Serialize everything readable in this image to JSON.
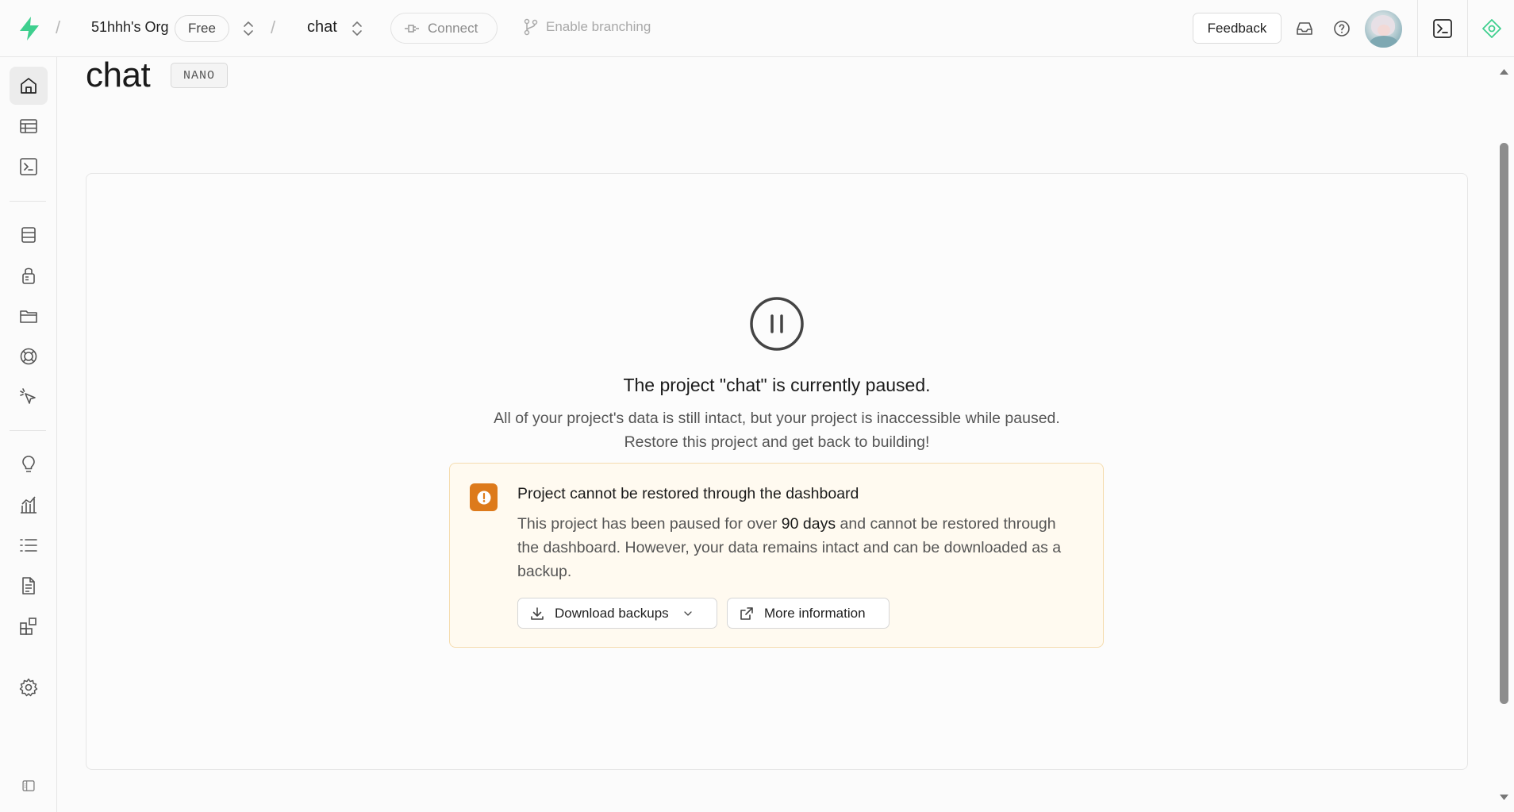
{
  "topbar": {
    "org_name": "51hhh's Org",
    "plan_badge": "Free",
    "project_name": "chat",
    "connect_label": "Connect",
    "branching_label": "Enable branching",
    "feedback_label": "Feedback"
  },
  "sidebar": {
    "items": [
      {
        "name": "home",
        "active": true
      },
      {
        "name": "table-editor"
      },
      {
        "name": "sql-editor"
      },
      {
        "name": "database"
      },
      {
        "name": "authentication"
      },
      {
        "name": "storage"
      },
      {
        "name": "edge-functions"
      },
      {
        "name": "realtime"
      },
      {
        "name": "advisors"
      },
      {
        "name": "reports"
      },
      {
        "name": "logs"
      },
      {
        "name": "api-docs"
      },
      {
        "name": "integrations"
      },
      {
        "name": "project-settings"
      }
    ]
  },
  "main": {
    "title": "chat",
    "compute_badge": "NANO",
    "paused_title": "The project \"chat\" is currently paused.",
    "paused_desc_line1": "All of your project's data is still intact, but your project is inaccessible while paused.",
    "paused_desc_line2": "Restore this project and get back to building!",
    "alert": {
      "title": "Project cannot be restored through the dashboard",
      "body_pre": "This project has been paused for over ",
      "body_strong": "90 days",
      "body_post": " and cannot be restored through the dashboard. However, your data remains intact and can be downloaded as a backup.",
      "download_label": "Download backups",
      "more_info_label": "More information"
    }
  },
  "colors": {
    "brand": "#3ecf8e",
    "warning": "#dd7a1b",
    "alert_bg": "#fffaf0",
    "alert_border": "#f5dcaf"
  }
}
